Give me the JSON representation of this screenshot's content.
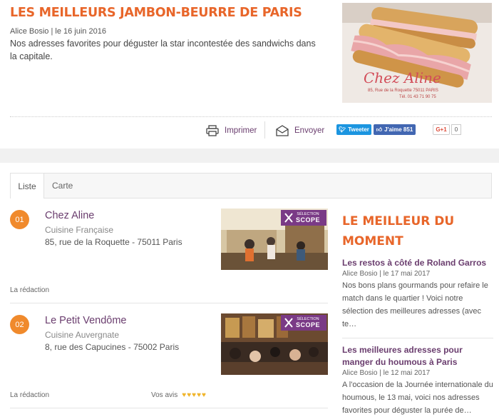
{
  "article": {
    "title": "LES MEILLEURS JAMBON-BEURRE DE PARIS",
    "meta": "Alice Bosio | le 16 juin 2016",
    "description": "Nos adresses favorites pour déguster la star incontestée des sandwichs dans la capitale.",
    "hero_lettering": "Chez Aline",
    "hero_address": "85, Rue de la Roquette 75011 PARIS",
    "hero_phone": "Tél. 01 43 71 90 75"
  },
  "share": {
    "print_label": "Imprimer",
    "send_label": "Envoyer",
    "tweet_label": "Tweeter",
    "like_label": "J'aime 851",
    "gplus_label": "G+1",
    "gplus_count": "0"
  },
  "tabs": [
    {
      "label": "Liste"
    },
    {
      "label": "Carte"
    }
  ],
  "items": [
    {
      "number": "01",
      "name": "Chez Aline",
      "cuisine": "Cuisine Française",
      "address": "85, rue de la Roquette - 75011 Paris",
      "byline": "La rédaction",
      "badge_small": "SÉLECTION",
      "badge_big": "SCOPE"
    },
    {
      "number": "02",
      "name": "Le Petit Vendôme",
      "cuisine": "Cuisine Auvergnate",
      "address": "8, rue des Capucines - 75002 Paris",
      "byline": "La rédaction",
      "reviews_label": "Vos avis",
      "rating": 5,
      "badge_small": "SÉLECTION",
      "badge_big": "SCOPE"
    }
  ],
  "sidebar": {
    "heading_line1": "LE MEILLEUR DU",
    "heading_line2": "MOMENT",
    "posts": [
      {
        "title": "Les restos à côté de Roland Garros",
        "meta": "Alice Bosio | le 17 mai 2017",
        "description": "Nos bons plans gourmands pour refaire le match dans le quartier ! Voici notre sélection des meilleures adresses (avec te…"
      },
      {
        "title": "Les meilleures adresses pour manger du houmous à Paris",
        "meta": "Alice Bosio | le 12 mai 2017",
        "description": "A l'occasion de la Journée internationale du houmous, le 13 mai, voici nos adresses favorites pour déguster la purée de…"
      }
    ]
  },
  "colors": {
    "accent_orange": "#e8662a",
    "link_purple": "#6a3d6e",
    "badge_purple": "#7a3a86",
    "twitter_blue": "#1b95e0",
    "facebook_blue": "#4267b2"
  }
}
